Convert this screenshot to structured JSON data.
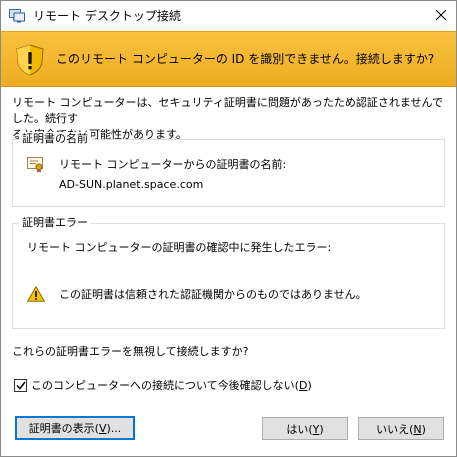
{
  "window": {
    "title": "リモート デスクトップ接続",
    "app_icon": "remote-desktop-icon",
    "close_icon": "close-icon"
  },
  "banner": {
    "icon": "shield-warning-icon",
    "text": "このリモート コンピューターの ID を識別できません。接続しますか?"
  },
  "description": {
    "line1": "リモート コンピューターは、セキュリティ証明書に問題があったため認証されませんでした。続行す",
    "line2": "ると安全でない可能性があります。"
  },
  "cert_name_group": {
    "label": "証明書の名前",
    "icon": "certificate-icon",
    "caption": "リモート コンピューターからの証明書の名前:",
    "value": "AD-SUN.planet.space.com"
  },
  "cert_error_group": {
    "label": "証明書エラー",
    "caption": "リモート コンピューターの証明書の確認中に発生したエラー:",
    "icon": "warning-icon",
    "error": "この証明書は信頼された認証機関からのものではありません。"
  },
  "question": "これらの証明書エラーを無視して接続しますか?",
  "checkbox": {
    "label": "このコンピューターへの接続について今後確認しない(",
    "accel": "D",
    "suffix": ")",
    "checked": true
  },
  "buttons": {
    "view_cert": {
      "label": "証明書の表示(",
      "accel": "V",
      "suffix": ")..."
    },
    "yes": {
      "label": "はい(",
      "accel": "Y",
      "suffix": ")"
    },
    "no": {
      "label": "いいえ(",
      "accel": "N",
      "suffix": ")"
    }
  }
}
